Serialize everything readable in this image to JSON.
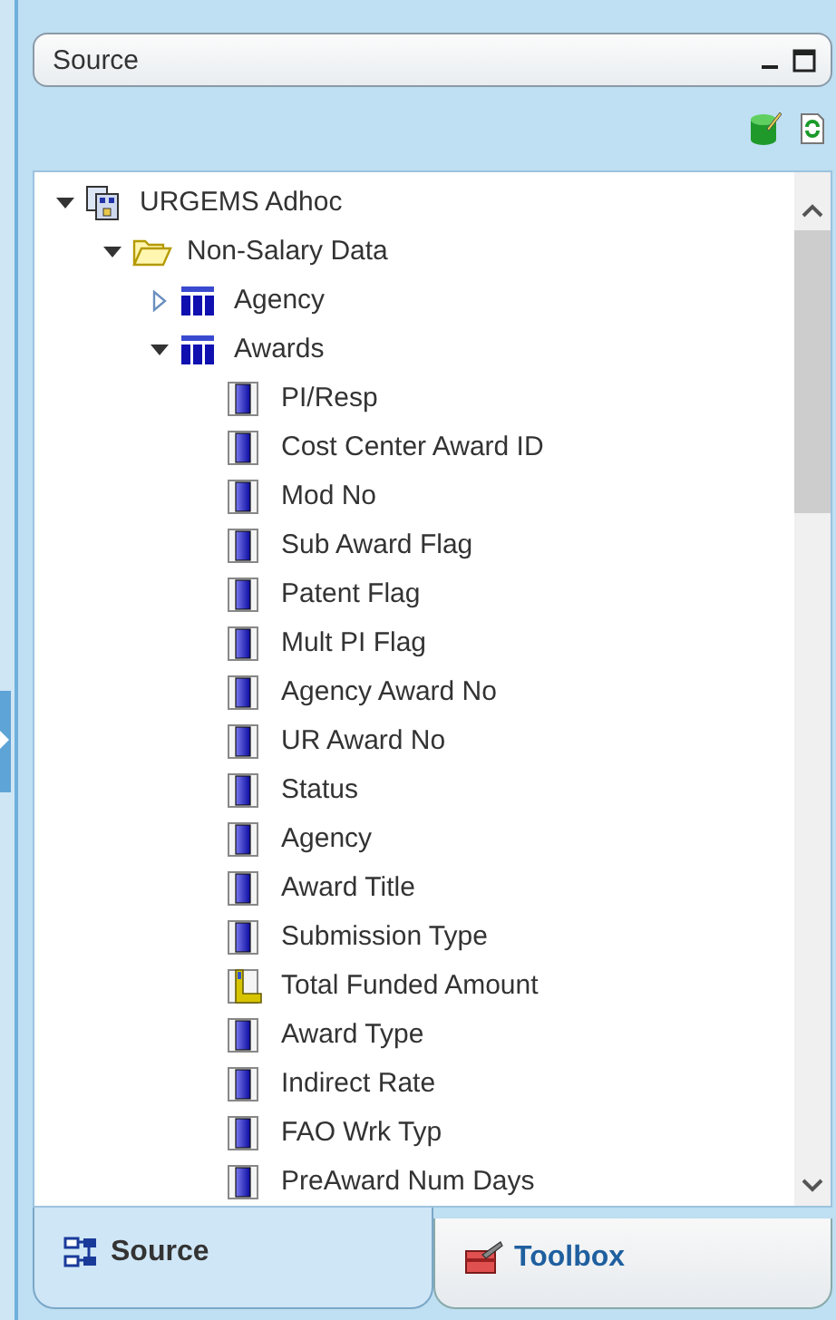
{
  "panel": {
    "title": "Source"
  },
  "tree": [
    {
      "label": "URGEMS Adhoc",
      "kind": "model",
      "expanded": true,
      "children": [
        {
          "label": "Non-Salary Data",
          "kind": "folder",
          "expanded": true,
          "children": [
            {
              "label": "Agency",
              "kind": "table",
              "expanded": false
            },
            {
              "label": "Awards",
              "kind": "table",
              "expanded": true,
              "children": [
                {
                  "label": "PI/Resp",
                  "kind": "column"
                },
                {
                  "label": "Cost Center Award ID",
                  "kind": "column"
                },
                {
                  "label": "Mod No",
                  "kind": "column"
                },
                {
                  "label": "Sub Award Flag",
                  "kind": "column"
                },
                {
                  "label": "Patent Flag",
                  "kind": "column"
                },
                {
                  "label": "Mult PI Flag",
                  "kind": "column"
                },
                {
                  "label": "Agency Award No",
                  "kind": "column"
                },
                {
                  "label": "UR Award No",
                  "kind": "column"
                },
                {
                  "label": "Status",
                  "kind": "column"
                },
                {
                  "label": "Agency",
                  "kind": "column"
                },
                {
                  "label": "Award Title",
                  "kind": "column"
                },
                {
                  "label": "Submission Type",
                  "kind": "column"
                },
                {
                  "label": "Total Funded Amount",
                  "kind": "measure"
                },
                {
                  "label": "Award Type",
                  "kind": "column"
                },
                {
                  "label": "Indirect Rate",
                  "kind": "column"
                },
                {
                  "label": "FAO Wrk Typ",
                  "kind": "column"
                },
                {
                  "label": "PreAward Num Days",
                  "kind": "column"
                }
              ]
            }
          ]
        }
      ]
    }
  ],
  "tabs": [
    {
      "label": "Source",
      "kind": "source",
      "selected": true
    },
    {
      "label": "Toolbox",
      "kind": "toolbox",
      "selected": false
    }
  ]
}
